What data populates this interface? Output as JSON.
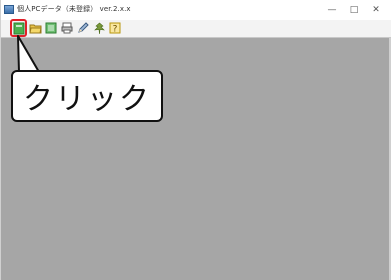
{
  "window": {
    "title": "個人PCデータ（未登録） ver.2.x.x",
    "min_label": "—",
    "max_label": "□",
    "close_label": "✕"
  },
  "toolbar": {
    "buttons": [
      {
        "name": "new-card",
        "icon": "green-book-icon",
        "highlighted": true
      },
      {
        "name": "open",
        "icon": "folder-open-icon"
      },
      {
        "name": "list-view",
        "icon": "green-list-icon"
      },
      {
        "name": "print",
        "icon": "printer-icon"
      },
      {
        "name": "edit",
        "icon": "pencil-icon"
      },
      {
        "name": "tree",
        "icon": "leaf-icon"
      },
      {
        "name": "help",
        "icon": "help-icon"
      }
    ],
    "highlight_color": "#e0202a"
  },
  "callout": {
    "text": "クリック"
  }
}
